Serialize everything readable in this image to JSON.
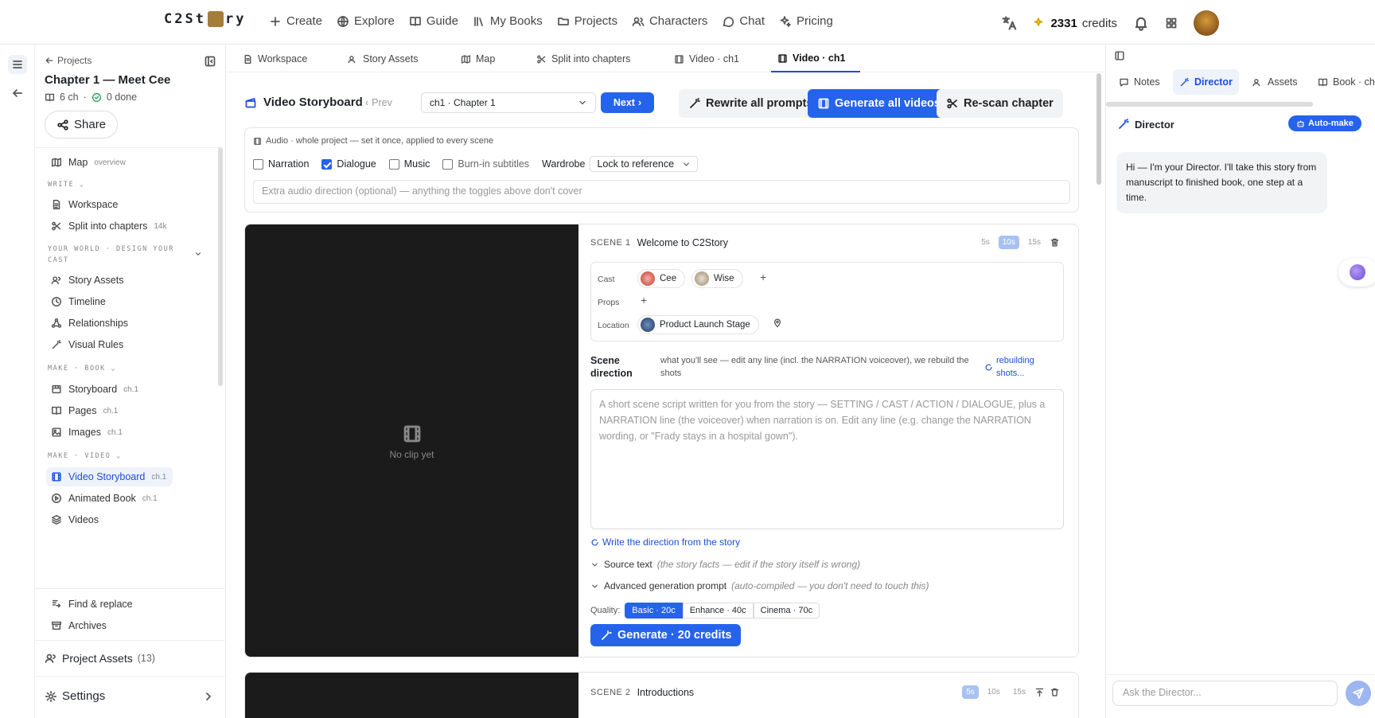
{
  "header": {
    "logo_left": "C2St",
    "logo_right": "ry",
    "nav": [
      "Create",
      "Explore",
      "Guide",
      "My Books",
      "Projects",
      "Characters",
      "Chat",
      "Pricing"
    ],
    "credits_value": "2331",
    "credits_label": "credits"
  },
  "sidebar": {
    "back_label": "Projects",
    "chapter_title": "Chapter 1 — Meet Cee",
    "chapters_count": "6 ch",
    "done_label": "0 done",
    "share_label": "Share",
    "map": {
      "label": "Map",
      "tag": "overview"
    },
    "sections": {
      "write": "WRITE",
      "world": "YOUR WORLD · DESIGN YOUR CAST",
      "book": "MAKE · BOOK",
      "video": "MAKE · VIDEO"
    },
    "items": {
      "workspace": "Workspace",
      "split": {
        "label": "Split into chapters",
        "tag": "14k"
      },
      "story_assets": "Story Assets",
      "timeline": "Timeline",
      "relationships": "Relationships",
      "visual_rules": "Visual Rules",
      "storyboard": {
        "label": "Storyboard",
        "tag": "ch.1"
      },
      "pages": {
        "label": "Pages",
        "tag": "ch.1"
      },
      "images": {
        "label": "Images",
        "tag": "ch.1"
      },
      "video_storyboard": {
        "label": "Video Storyboard",
        "tag": "ch.1"
      },
      "animated_book": {
        "label": "Animated Book",
        "tag": "ch.1"
      },
      "videos": "Videos",
      "find_replace": "Find & replace",
      "archives": "Archives"
    },
    "project_assets_label": "Project Assets",
    "project_assets_count": "(13)",
    "settings_label": "Settings"
  },
  "tabs": [
    "Workspace",
    "Story Assets",
    "Map",
    "Split into chapters",
    "Video · ch1",
    "Video · ch1"
  ],
  "toolbar": {
    "title": "Video Storyboard",
    "prev": "Prev",
    "chapter": "ch1 · Chapter 1",
    "next": "Next",
    "rewrite": "Rewrite all prompts",
    "generate_all": "Generate all videos",
    "rescan": "Re-scan chapter"
  },
  "audio": {
    "header": "Audio · whole project — set it once, applied to every scene",
    "narration": "Narration",
    "dialogue": "Dialogue",
    "music": "Music",
    "burnin": "Burn-in subtitles",
    "wardrobe_label": "Wardrobe",
    "wardrobe_value": "Lock to reference",
    "direction_placeholder": "Extra audio direction (optional) — anything the toggles above don't cover",
    "narration_checked": false,
    "dialogue_checked": true,
    "music_checked": false,
    "burnin_checked": false
  },
  "scene1": {
    "num": "SCENE 1",
    "title": "Welcome to C2Story",
    "durations": [
      "5s",
      "10s",
      "15s"
    ],
    "selected_duration": "10s",
    "cast_label": "Cast",
    "cast": [
      "Cee",
      "Wise"
    ],
    "props_label": "Props",
    "location_label": "Location",
    "location": "Product Launch Stage",
    "no_clip": "No clip yet",
    "direction_label_1": "Scene",
    "direction_label_2": "direction",
    "direction_hint": "what you'll see — edit any line (incl. the NARRATION voiceover), we rebuild the shots",
    "rebuilding_1": "rebuilding",
    "rebuilding_2": "shots...",
    "direction_placeholder": "A short scene script written for you from the story — SETTING / CAST / ACTION / DIALOGUE, plus a NARRATION line (the voiceover) when narration is on. Edit any line (e.g. change the NARRATION wording, or \"Frady stays in a hospital gown\").",
    "write_link": "Write the direction from the story",
    "source_label": "Source text",
    "source_hint": "(the story facts — edit if the story itself is wrong)",
    "advanced_label": "Advanced generation prompt",
    "advanced_hint": "(auto-compiled — you don't need to touch this)",
    "quality_label": "Quality:",
    "quality_options": [
      "Basic · 20c",
      "Enhance · 40c",
      "Cinema · 70c"
    ],
    "generate": "Generate · 20 credits"
  },
  "scene2": {
    "num": "SCENE 2",
    "title": "Introductions",
    "durations": [
      "5s",
      "10s",
      "15s"
    ],
    "selected_duration": "5s"
  },
  "right_panel": {
    "tabs": [
      "Notes",
      "Director",
      "Assets",
      "Book · ch"
    ],
    "director_title": "Director",
    "automake": "Auto-make",
    "message": "Hi — I'm your Director. I'll take this story from manuscript to finished book, one step at a time.",
    "ask_placeholder": "Ask the Director..."
  }
}
